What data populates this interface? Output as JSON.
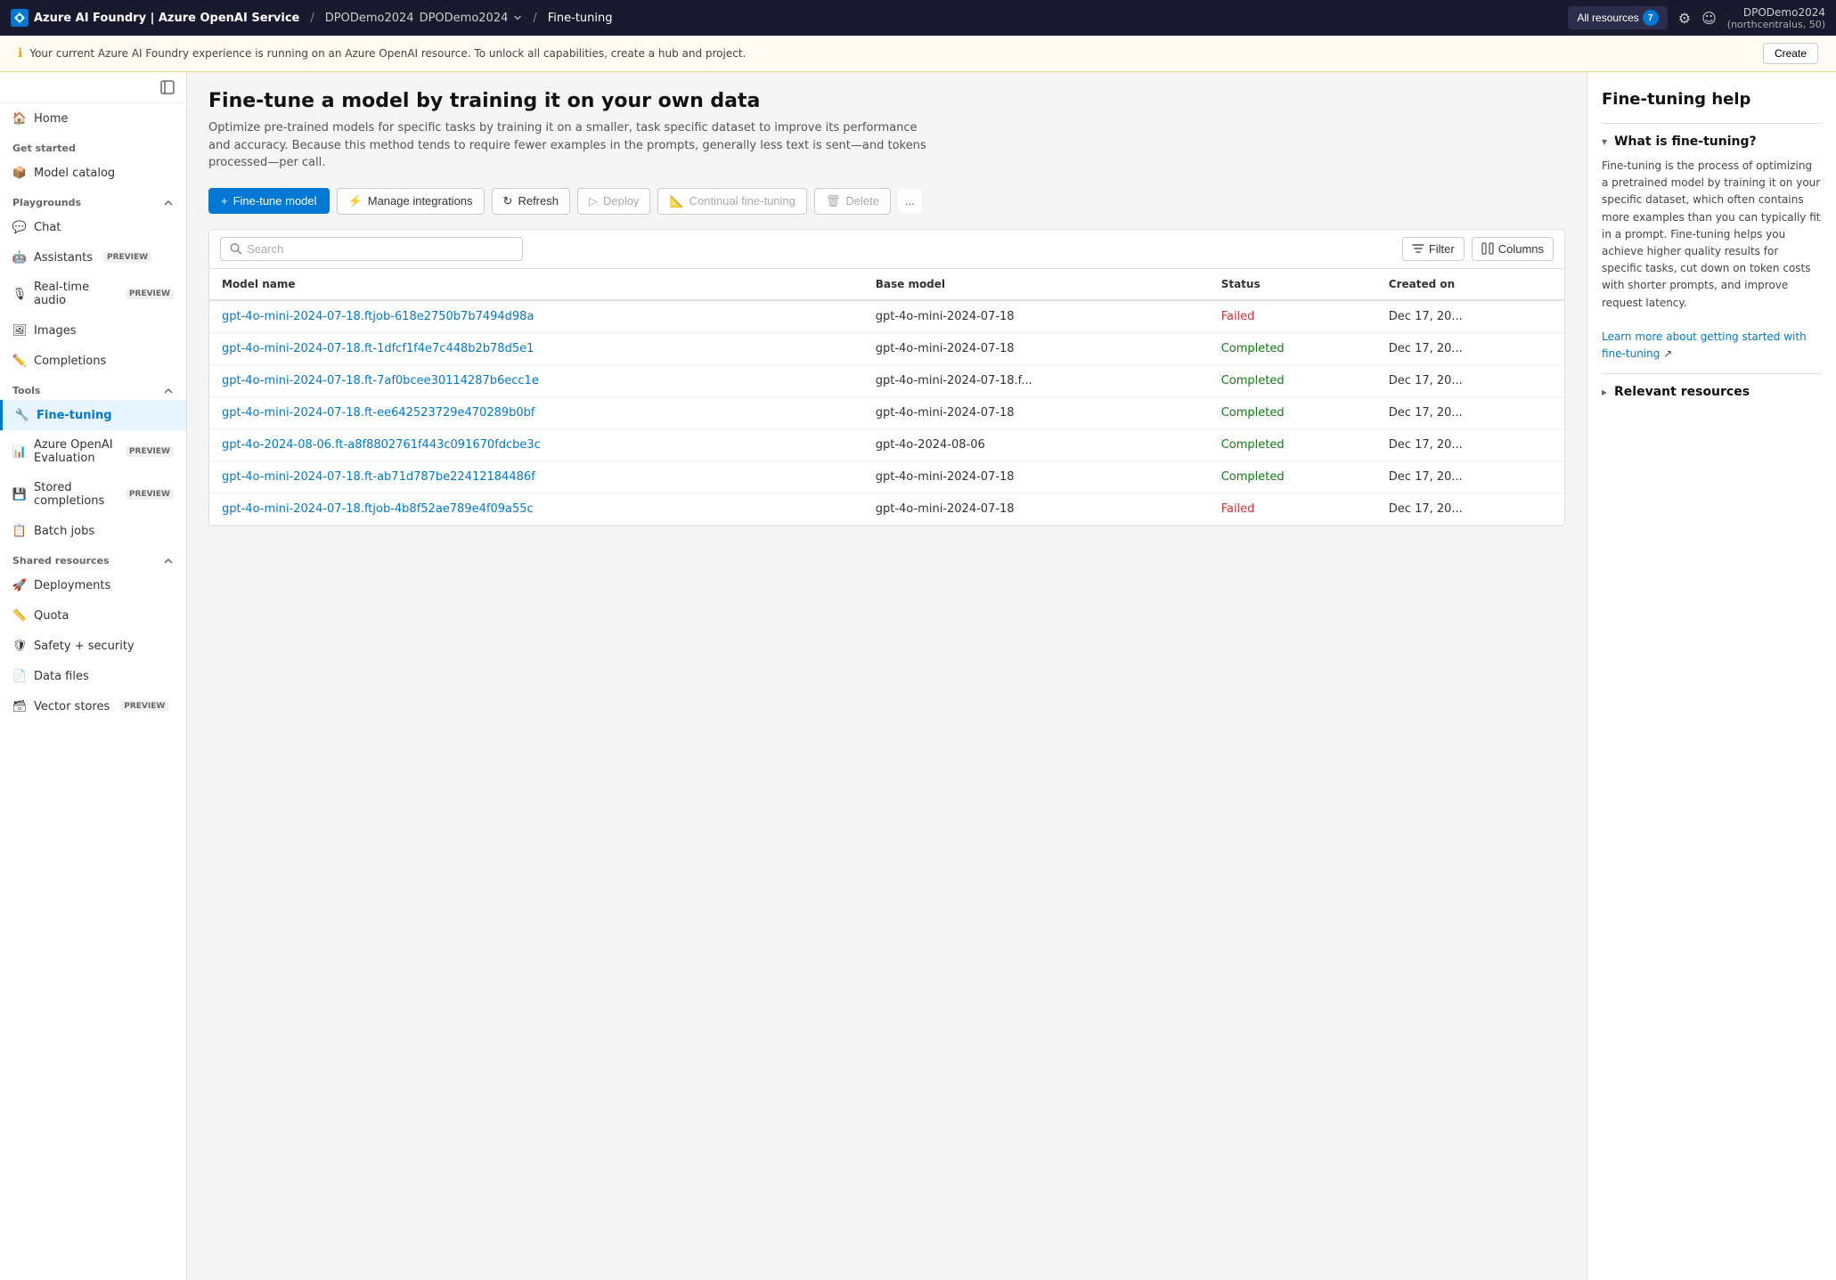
{
  "topbar": {
    "logo_text": "Azure AI Foundry | Azure OpenAI Service",
    "breadcrumb_middle": "DPODemo2024",
    "breadcrumb_current": "Fine-tuning",
    "resources_label": "All resources",
    "resources_count": "7",
    "user_name": "DPODemo2024",
    "user_region": "(northcentralus, 50)"
  },
  "banner": {
    "message": "Your current Azure AI Foundry experience is running on an Azure OpenAI resource. To unlock all capabilities, create a hub and project.",
    "create_label": "Create"
  },
  "sidebar": {
    "home_label": "Home",
    "get_started_label": "Get started",
    "model_catalog_label": "Model catalog",
    "playgrounds_label": "Playgrounds",
    "playgrounds_group": "Playgrounds",
    "chat_label": "Chat",
    "assistants_label": "Assistants",
    "assistants_preview": "PREVIEW",
    "realtime_label": "Real-time audio",
    "realtime_preview": "PREVIEW",
    "images_label": "Images",
    "completions_label": "Completions",
    "tools_group": "Tools",
    "fine_tuning_label": "Fine-tuning",
    "azure_openai_eval_label": "Azure OpenAI Evaluation",
    "azure_openai_eval_preview": "PREVIEW",
    "stored_completions_label": "Stored completions",
    "stored_completions_preview": "PREVIEW",
    "batch_jobs_label": "Batch jobs",
    "shared_resources_group": "Shared resources",
    "deployments_label": "Deployments",
    "quota_label": "Quota",
    "safety_security_label": "Safety + security",
    "data_files_label": "Data files",
    "vector_stores_label": "Vector stores",
    "vector_stores_preview": "PREVIEW"
  },
  "page": {
    "title": "Fine-tune a model by training it on your own data",
    "description": "Optimize pre-trained models for specific tasks by training it on a smaller, task specific dataset to improve its performance and accuracy. Because this method tends to require fewer examples in the prompts, generally less text is sent—and tokens processed—per call.",
    "fine_tune_btn": "+ Fine-tune model",
    "manage_integrations_btn": "Manage integrations",
    "refresh_btn": "Refresh",
    "deploy_btn": "Deploy",
    "continual_fine_tuning_btn": "Continual fine-tuning",
    "delete_btn": "Delete",
    "more_btn": "...",
    "search_placeholder": "Search",
    "filter_btn": "Filter",
    "columns_btn": "Columns"
  },
  "table": {
    "headers": [
      "Model name",
      "Base model",
      "Status",
      "Created on"
    ],
    "rows": [
      {
        "model_name": "gpt-4o-mini-2024-07-18.ftjob-618e2750b7b7494d98a",
        "base_model": "gpt-4o-mini-2024-07-18",
        "status": "Failed",
        "created_on": "Dec 17, 20..."
      },
      {
        "model_name": "gpt-4o-mini-2024-07-18.ft-1dfcf1f4e7c448b2b78d5e1",
        "base_model": "gpt-4o-mini-2024-07-18",
        "status": "Completed",
        "created_on": "Dec 17, 20..."
      },
      {
        "model_name": "gpt-4o-mini-2024-07-18.ft-7af0bcee30114287b6ecc1e",
        "base_model": "gpt-4o-mini-2024-07-18.f...",
        "status": "Completed",
        "created_on": "Dec 17, 20..."
      },
      {
        "model_name": "gpt-4o-mini-2024-07-18.ft-ee642523729e470289b0bf",
        "base_model": "gpt-4o-mini-2024-07-18",
        "status": "Completed",
        "created_on": "Dec 17, 20..."
      },
      {
        "model_name": "gpt-4o-2024-08-06.ft-a8f8802761f443c091670fdcbe3c",
        "base_model": "gpt-4o-2024-08-06",
        "status": "Completed",
        "created_on": "Dec 17, 20..."
      },
      {
        "model_name": "gpt-4o-mini-2024-07-18.ft-ab71d787be22412184486f",
        "base_model": "gpt-4o-mini-2024-07-18",
        "status": "Completed",
        "created_on": "Dec 17, 20..."
      },
      {
        "model_name": "gpt-4o-mini-2024-07-18.ftjob-4b8f52ae789e4f09a55c",
        "base_model": "gpt-4o-mini-2024-07-18",
        "status": "Failed",
        "created_on": "Dec 17, 20..."
      }
    ]
  },
  "right_panel": {
    "title": "Fine-tuning help",
    "what_is_title": "What is fine-tuning?",
    "what_is_body": "Fine-tuning is the process of optimizing a pretrained model by training it on your specific dataset, which often contains more examples than you can typically fit in a prompt. Fine-tuning helps you achieve higher quality results for specific tasks, cut down on token costs with shorter prompts, and improve request latency.",
    "learn_more_link": "Learn more about getting started with fine-tuning",
    "relevant_resources_title": "Relevant resources"
  }
}
